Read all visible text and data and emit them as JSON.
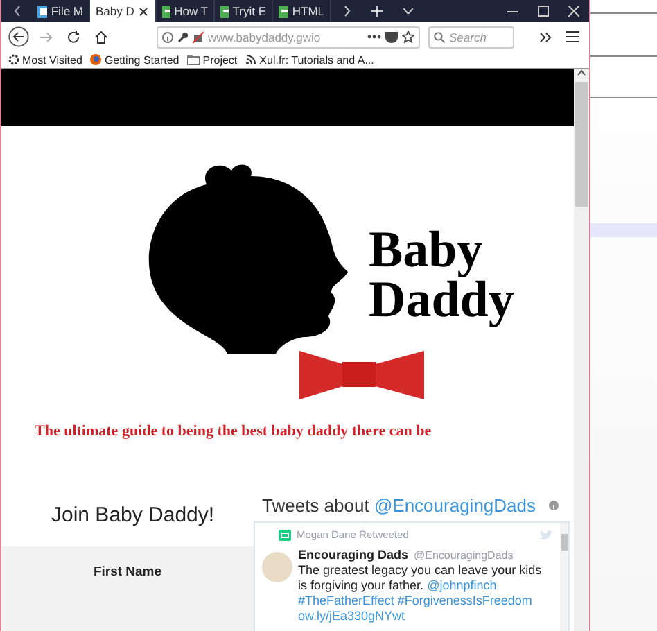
{
  "browser": {
    "tabs": [
      {
        "label": "File M",
        "kind": "file",
        "selected": false
      },
      {
        "label": "Baby D",
        "kind": "none",
        "selected": true
      },
      {
        "label": "How T",
        "kind": "w3",
        "selected": false
      },
      {
        "label": "Tryit E",
        "kind": "w3",
        "selected": false
      },
      {
        "label": "HTML",
        "kind": "w3",
        "selected": false
      }
    ],
    "url": "www.babydaddy.gwio",
    "search": {
      "placeholder": "Search"
    },
    "bookmarks": [
      {
        "label": "Most Visited",
        "kind": "gear"
      },
      {
        "label": "Getting Started",
        "kind": "firefox"
      },
      {
        "label": "Project",
        "kind": "folder"
      },
      {
        "label": "Xul.fr: Tutorials and A...",
        "kind": "feed"
      }
    ]
  },
  "page": {
    "brand": [
      "Baby",
      "Daddy"
    ],
    "tagline": "The ultimate guide to being the best baby daddy there can be",
    "join_title": "Join Baby Daddy!",
    "form_label": "First Name",
    "tweets": {
      "title": "Tweets about ",
      "handle": "@EncouragingDads",
      "retweet_by": "Mogan Dane Retweeted",
      "author": "Encouraging Dads",
      "author_handle": "@EncouragingDads",
      "body": [
        {
          "text": "The greatest legacy you can leave your kids is forgiving your father.",
          "kind": "plain"
        },
        {
          "text": "@johnpfinch",
          "kind": "link"
        },
        {
          "text": "#TheFatherEffect",
          "kind": "link"
        },
        {
          "text": "#ForgivenessIsFreedom",
          "kind": "link"
        },
        {
          "text": "ow.ly/jEa330gNYwt",
          "kind": "link"
        }
      ]
    }
  }
}
